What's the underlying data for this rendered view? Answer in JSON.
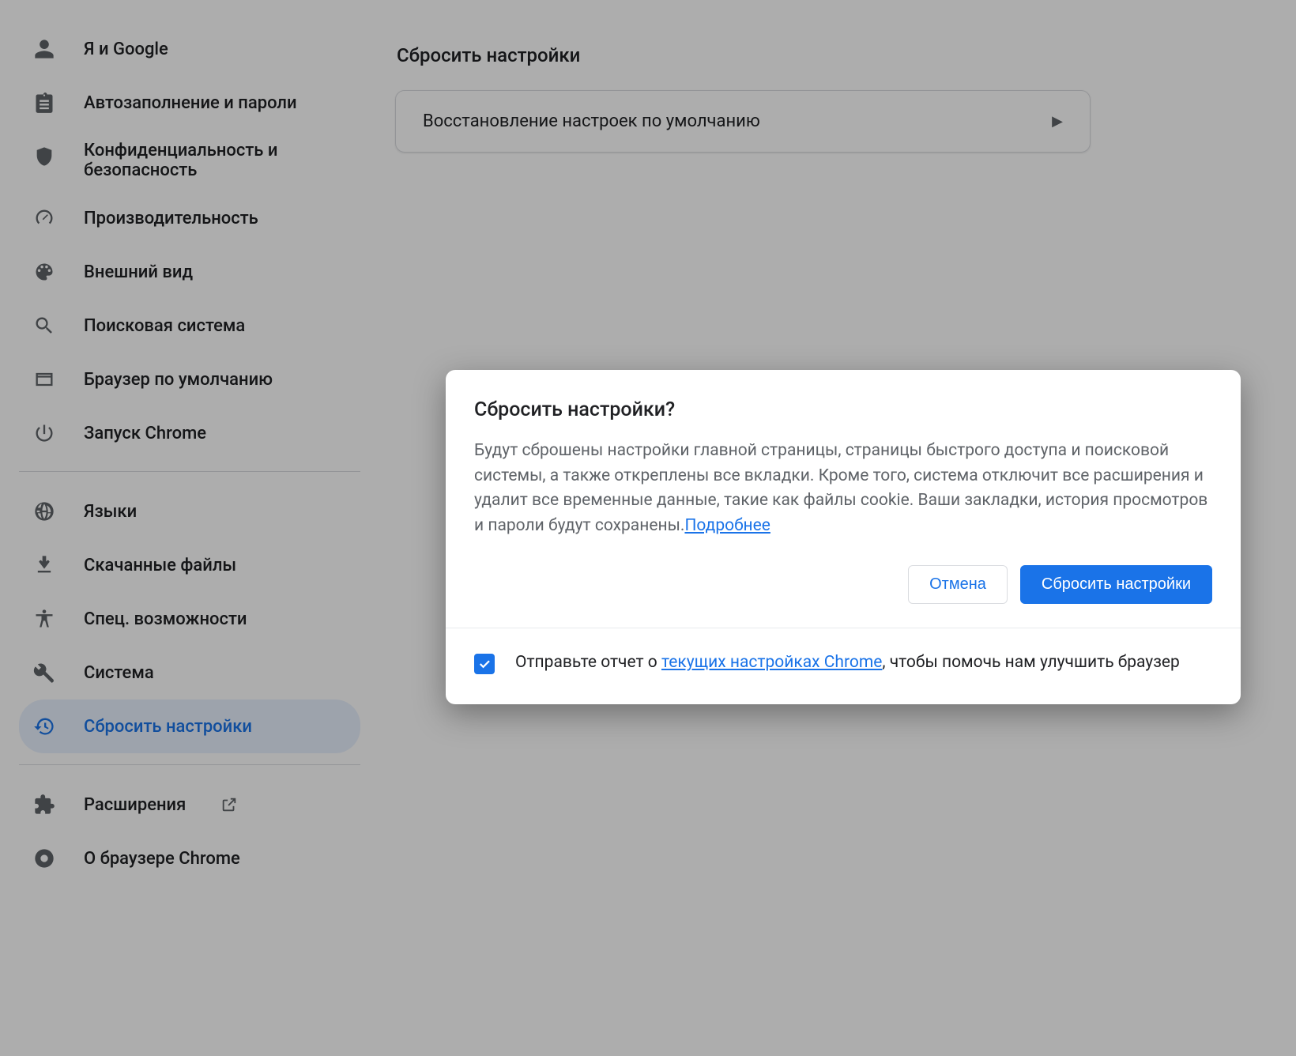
{
  "sidebar": {
    "items": [
      {
        "id": "you-and-google",
        "label": "Я и Google"
      },
      {
        "id": "autofill",
        "label": "Автозаполнение и пароли"
      },
      {
        "id": "privacy",
        "label": "Конфиденциальность и безопасность"
      },
      {
        "id": "performance",
        "label": "Производительность"
      },
      {
        "id": "appearance",
        "label": "Внешний вид"
      },
      {
        "id": "search",
        "label": "Поисковая система"
      },
      {
        "id": "default-browser",
        "label": "Браузер по умолчанию"
      },
      {
        "id": "on-startup",
        "label": "Запуск Chrome"
      },
      {
        "id": "languages",
        "label": "Языки"
      },
      {
        "id": "downloads",
        "label": "Скачанные файлы"
      },
      {
        "id": "accessibility",
        "label": "Спец. возможности"
      },
      {
        "id": "system",
        "label": "Система"
      },
      {
        "id": "reset",
        "label": "Сбросить настройки",
        "active": true
      },
      {
        "id": "extensions",
        "label": "Расширения"
      },
      {
        "id": "about",
        "label": "О браузере Chrome"
      }
    ]
  },
  "main": {
    "heading": "Сбросить настройки",
    "card_label": "Восстановление настроек по умолчанию"
  },
  "dialog": {
    "title": "Сбросить настройки?",
    "body_text": "Будут сброшены настройки главной страницы, страницы быстрого доступа и поисковой системы, а также откреплены все вкладки. Кроме того, система отключит все расширения и удалит все временные данные, такие как файлы cookie. Ваши закладки, история просмотров и пароли будут сохранены.",
    "learn_more": "Подробнее",
    "cancel": "Отмена",
    "confirm": "Сбросить настройки",
    "footer_before": "Отправьте отчет о ",
    "footer_link": "текущих настройках Chrome",
    "footer_after": ", чтобы помочь нам улучшить браузер",
    "checkbox_checked": true
  }
}
